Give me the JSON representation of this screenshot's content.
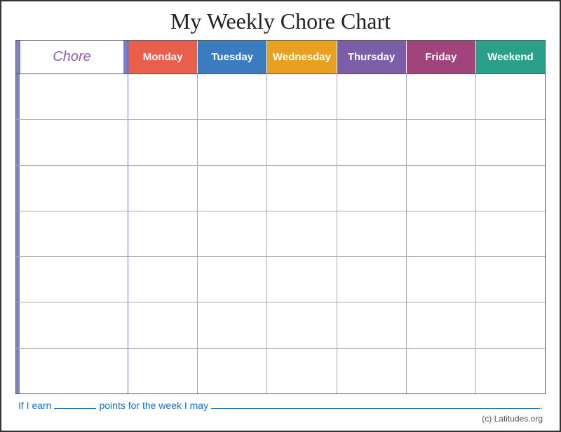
{
  "page": {
    "title": "My Weekly Chore Chart",
    "chore_label": "Chore",
    "days": [
      {
        "label": "Monday",
        "css_class": "monday-bg"
      },
      {
        "label": "Tuesday",
        "css_class": "tuesday-bg"
      },
      {
        "label": "Wednesday",
        "css_class": "wednesday-bg"
      },
      {
        "label": "Thursday",
        "css_class": "thursday-bg"
      },
      {
        "label": "Friday",
        "css_class": "friday-bg"
      },
      {
        "label": "Weekend",
        "css_class": "weekend-bg"
      }
    ],
    "rows": 7,
    "footer": {
      "earn_prefix": "If I earn",
      "earn_middle": "points for the week I may",
      "period": "."
    },
    "copyright": "(c) Latitudes.org"
  }
}
